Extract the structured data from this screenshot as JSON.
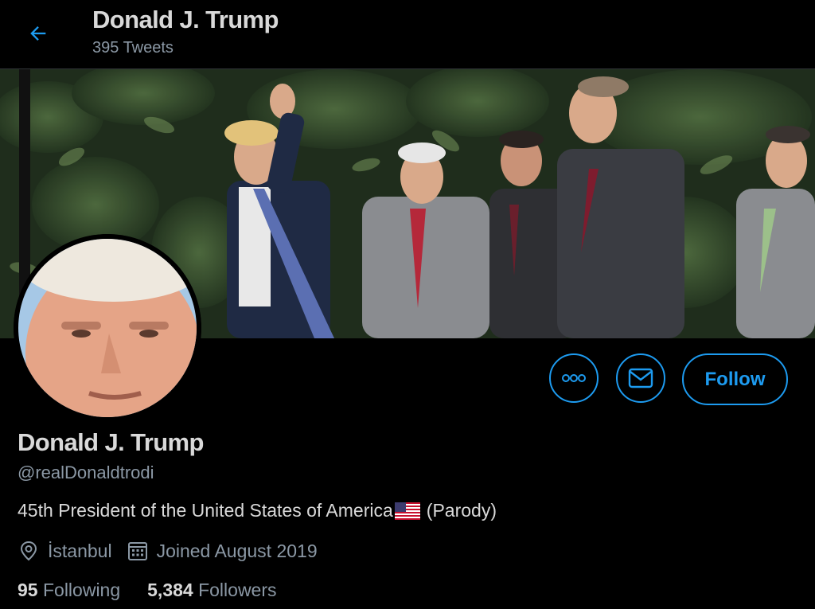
{
  "header": {
    "title": "Donald J. Trump",
    "tweet_count": "395 Tweets",
    "back_icon": "arrow-left-icon"
  },
  "profile": {
    "name": "Donald J. Trump",
    "handle": "@realDonaldtrodi",
    "bio_text": "45th President of the United States of America",
    "bio_suffix": "(Parody)",
    "location": "İstanbul",
    "joined": "Joined August 2019",
    "following_count": "95",
    "following_label": "Following",
    "followers_count": "5,384",
    "followers_label": "Followers"
  },
  "actions": {
    "more_icon": "more-horizontal-icon",
    "message_icon": "envelope-icon",
    "follow_label": "Follow"
  },
  "colors": {
    "background": "#000000",
    "accent": "#1d9bf0",
    "primary_text": "#d9d9d9",
    "secondary_text": "#8b98a5"
  }
}
